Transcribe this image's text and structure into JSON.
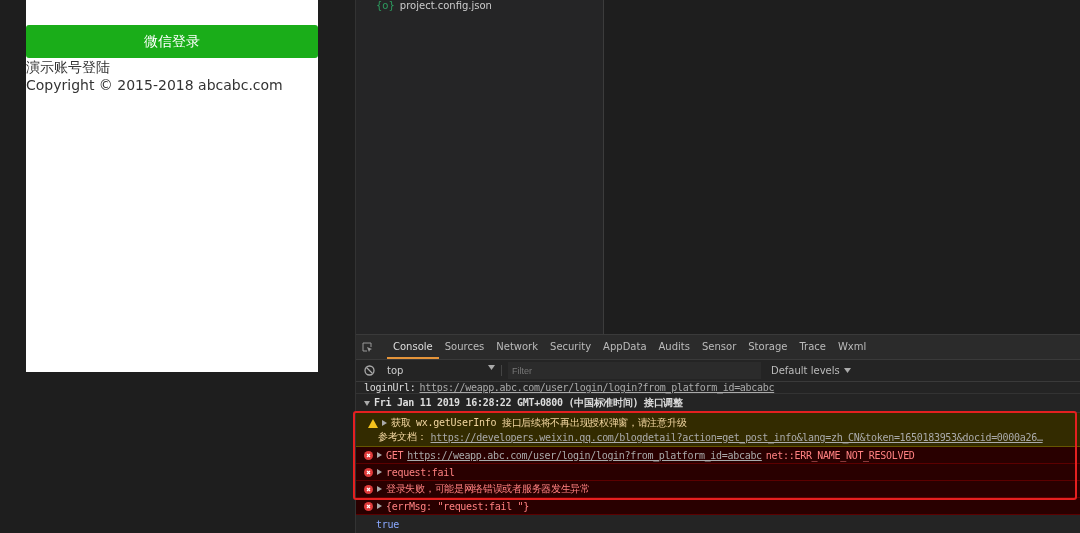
{
  "simulator": {
    "login_button": "微信登录",
    "demo_link": "演示账号登陆",
    "copyright": "Copyright © 2015-2018 abcabc.com"
  },
  "file_tree": {
    "items": [
      {
        "name": "project.config.json",
        "icon": "{o}"
      }
    ]
  },
  "devtools": {
    "tabs": [
      {
        "label": "Console",
        "selected": true
      },
      {
        "label": "Sources",
        "selected": false
      },
      {
        "label": "Network",
        "selected": false
      },
      {
        "label": "Security",
        "selected": false
      },
      {
        "label": "AppData",
        "selected": false
      },
      {
        "label": "Audits",
        "selected": false
      },
      {
        "label": "Sensor",
        "selected": false
      },
      {
        "label": "Storage",
        "selected": false
      },
      {
        "label": "Trace",
        "selected": false
      },
      {
        "label": "Wxml",
        "selected": false
      }
    ],
    "context": "top",
    "filter_placeholder": "Filter",
    "levels": "Default levels",
    "messages": [
      {
        "kind": "log",
        "highlighted": false,
        "text": "loginUrl:",
        "link": "https://weapp.abc.com/user/login/login?from_platform_id=abcabc"
      },
      {
        "kind": "group",
        "highlighted": false,
        "expanded": true,
        "text": "Fri Jan 11 2019 16:28:22 GMT+0800 (中国标准时间) 接口调整"
      },
      {
        "kind": "warning",
        "highlighted": true,
        "expanded": false,
        "text": "获取 wx.getUserInfo 接口后续将不再出现授权弹窗，请注意升级",
        "text2": "参考文档：",
        "link": "https://developers.weixin.qq.com/blogdetail?action=get_post_info&lang=zh_CN&token=1650183953&docid=0000a26…"
      },
      {
        "kind": "error",
        "highlighted": true,
        "expanded": false,
        "text": "GET",
        "link": "https://weapp.abc.com/user/login/login?from_platform_id=abcabc",
        "suffix": "net::ERR_NAME_NOT_RESOLVED"
      },
      {
        "kind": "error",
        "highlighted": true,
        "expanded": false,
        "text": "request:fail"
      },
      {
        "kind": "error",
        "highlighted": true,
        "expanded": false,
        "text": "登录失败，可能是网络错误或者服务器发生异常"
      },
      {
        "kind": "error",
        "highlighted": false,
        "expanded": false,
        "text": "{errMsg: \"request:fail \"}"
      },
      {
        "kind": "result",
        "highlighted": false,
        "text": "true"
      }
    ]
  }
}
